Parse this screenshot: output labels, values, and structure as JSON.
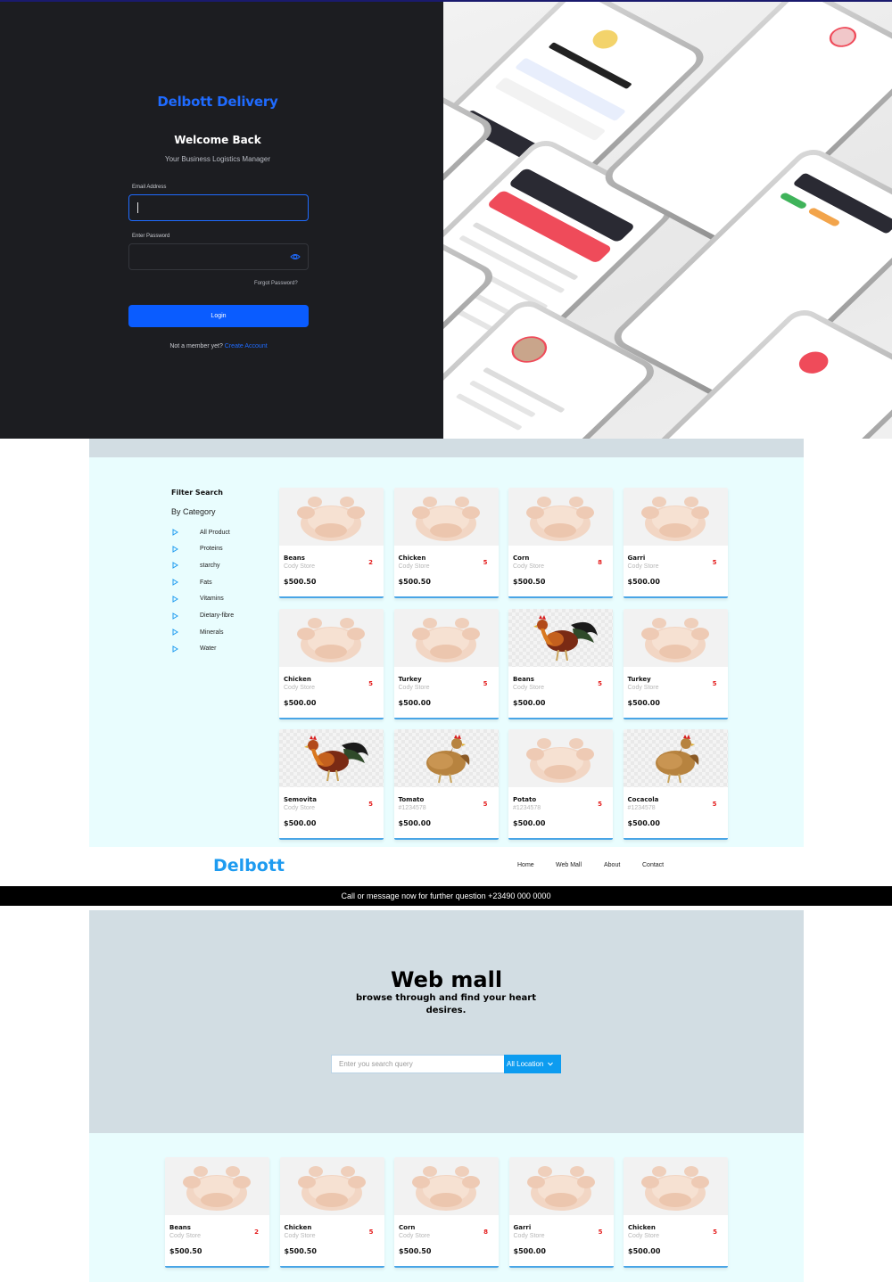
{
  "login": {
    "brand": "Delbott Delivery",
    "welcome": "Welcome Back",
    "subtitle": "Your Business Logistics Manager",
    "email_label": "Email Address",
    "email_value": "",
    "password_label": "Enter Password",
    "password_value": "",
    "forgot": "Forgot Password?",
    "login_button": "Login",
    "member_prompt": "Not a member yet?",
    "create_account": "Create Account",
    "accent_color": "#1f6bff"
  },
  "filter": {
    "title": "Filter Search",
    "by_category": "By Category",
    "categories": [
      "All Product",
      "Proteins",
      "starchy",
      "Fats",
      "Vitamins",
      "Dietary-fibre",
      "Minerals",
      "Water"
    ]
  },
  "products": [
    {
      "name": "Beans",
      "store": "Cody Store",
      "qty": "2",
      "price": "$500.50",
      "image": "chicken-raw"
    },
    {
      "name": "Chicken",
      "store": "Cody Store",
      "qty": "5",
      "price": "$500.50",
      "image": "chicken-raw"
    },
    {
      "name": "Corn",
      "store": "Cody Store",
      "qty": "8",
      "price": "$500.50",
      "image": "chicken-raw"
    },
    {
      "name": "Garri",
      "store": "Cody Store",
      "qty": "5",
      "price": "$500.00",
      "image": "chicken-raw"
    },
    {
      "name": "Chicken",
      "store": "Cody Store",
      "qty": "5",
      "price": "$500.00",
      "image": "chicken-raw"
    },
    {
      "name": "Turkey",
      "store": "Cody Store",
      "qty": "5",
      "price": "$500.00",
      "image": "chicken-raw"
    },
    {
      "name": "Beans",
      "store": "Cody Store",
      "qty": "5",
      "price": "$500.00",
      "image": "rooster"
    },
    {
      "name": "Turkey",
      "store": "Cody Store",
      "qty": "5",
      "price": "$500.00",
      "image": "chicken-raw"
    },
    {
      "name": "Semovita",
      "store": "Cody Store",
      "qty": "5",
      "price": "$500.00",
      "image": "rooster"
    },
    {
      "name": "Tomato",
      "store": "#1234578",
      "qty": "5",
      "price": "$500.00",
      "image": "hen"
    },
    {
      "name": "Potato",
      "store": "#1234578",
      "qty": "5",
      "price": "$500.00",
      "image": "chicken-raw"
    },
    {
      "name": "Cocacola",
      "store": "#1234578",
      "qty": "5",
      "price": "$500.00",
      "image": "hen"
    }
  ],
  "nav": {
    "logo": "Delbott",
    "links": [
      "Home",
      "Web Mall",
      "About",
      "Contact"
    ],
    "brand_color": "#1e9bf0"
  },
  "announcement": "Call or message now for further question +23490 000 0000",
  "hero": {
    "title": "Web mall",
    "subtitle": "browse through and find your heart desires.",
    "search_placeholder": "Enter you search query",
    "location": "All Location"
  },
  "bottom_products": [
    {
      "name": "Beans",
      "store": "Cody Store",
      "qty": "2",
      "price": "$500.50",
      "image": "chicken-raw"
    },
    {
      "name": "Chicken",
      "store": "Cody Store",
      "qty": "5",
      "price": "$500.50",
      "image": "chicken-raw"
    },
    {
      "name": "Corn",
      "store": "Cody Store",
      "qty": "8",
      "price": "$500.50",
      "image": "chicken-raw"
    },
    {
      "name": "Garri",
      "store": "Cody Store",
      "qty": "5",
      "price": "$500.00",
      "image": "chicken-raw"
    },
    {
      "name": "Chicken",
      "store": "Cody Store",
      "qty": "5",
      "price": "$500.00",
      "image": "chicken-raw"
    }
  ]
}
